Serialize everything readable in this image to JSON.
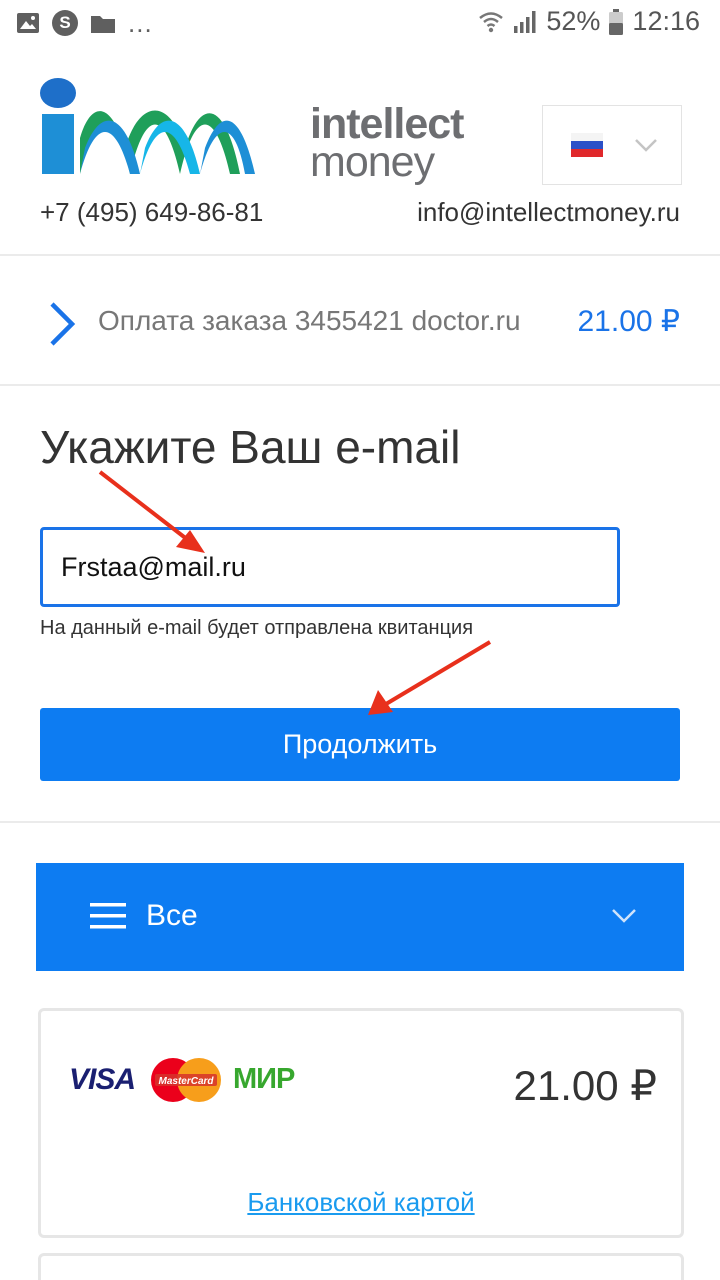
{
  "status_bar": {
    "overflow_dots": "...",
    "battery": "52%",
    "time": "12:16",
    "icons": [
      "image-icon",
      "skype-icon",
      "folder-icon",
      "wifi-icon",
      "signal-icon",
      "battery-icon"
    ]
  },
  "header": {
    "brand_line1": "intellect",
    "brand_line2": "money",
    "language": "Russian flag",
    "phone": "+7 (495) 649-86-81",
    "email": "info@intellectmoney.ru"
  },
  "order": {
    "description": "Оплата заказа 3455421 doctor.ru",
    "amount": "21.00 ₽"
  },
  "email_form": {
    "heading": "Укажите Ваш e-mail",
    "email_value": "Frstaa@mail.ru",
    "hint": "На данный e-mail будет отправлена квитанция",
    "continue_label": "Продолжить"
  },
  "payment_filter": {
    "selected": "Все"
  },
  "payment_option": {
    "brand_visa": "VISA",
    "brand_mastercard": "MasterCard",
    "brand_mir": "МИР",
    "amount": "21.00 ₽",
    "method_label": "Банковской картой"
  },
  "colors": {
    "accent": "#0d7cf2",
    "link": "#1a9bef",
    "annotation_arrow": "#e8301c"
  }
}
